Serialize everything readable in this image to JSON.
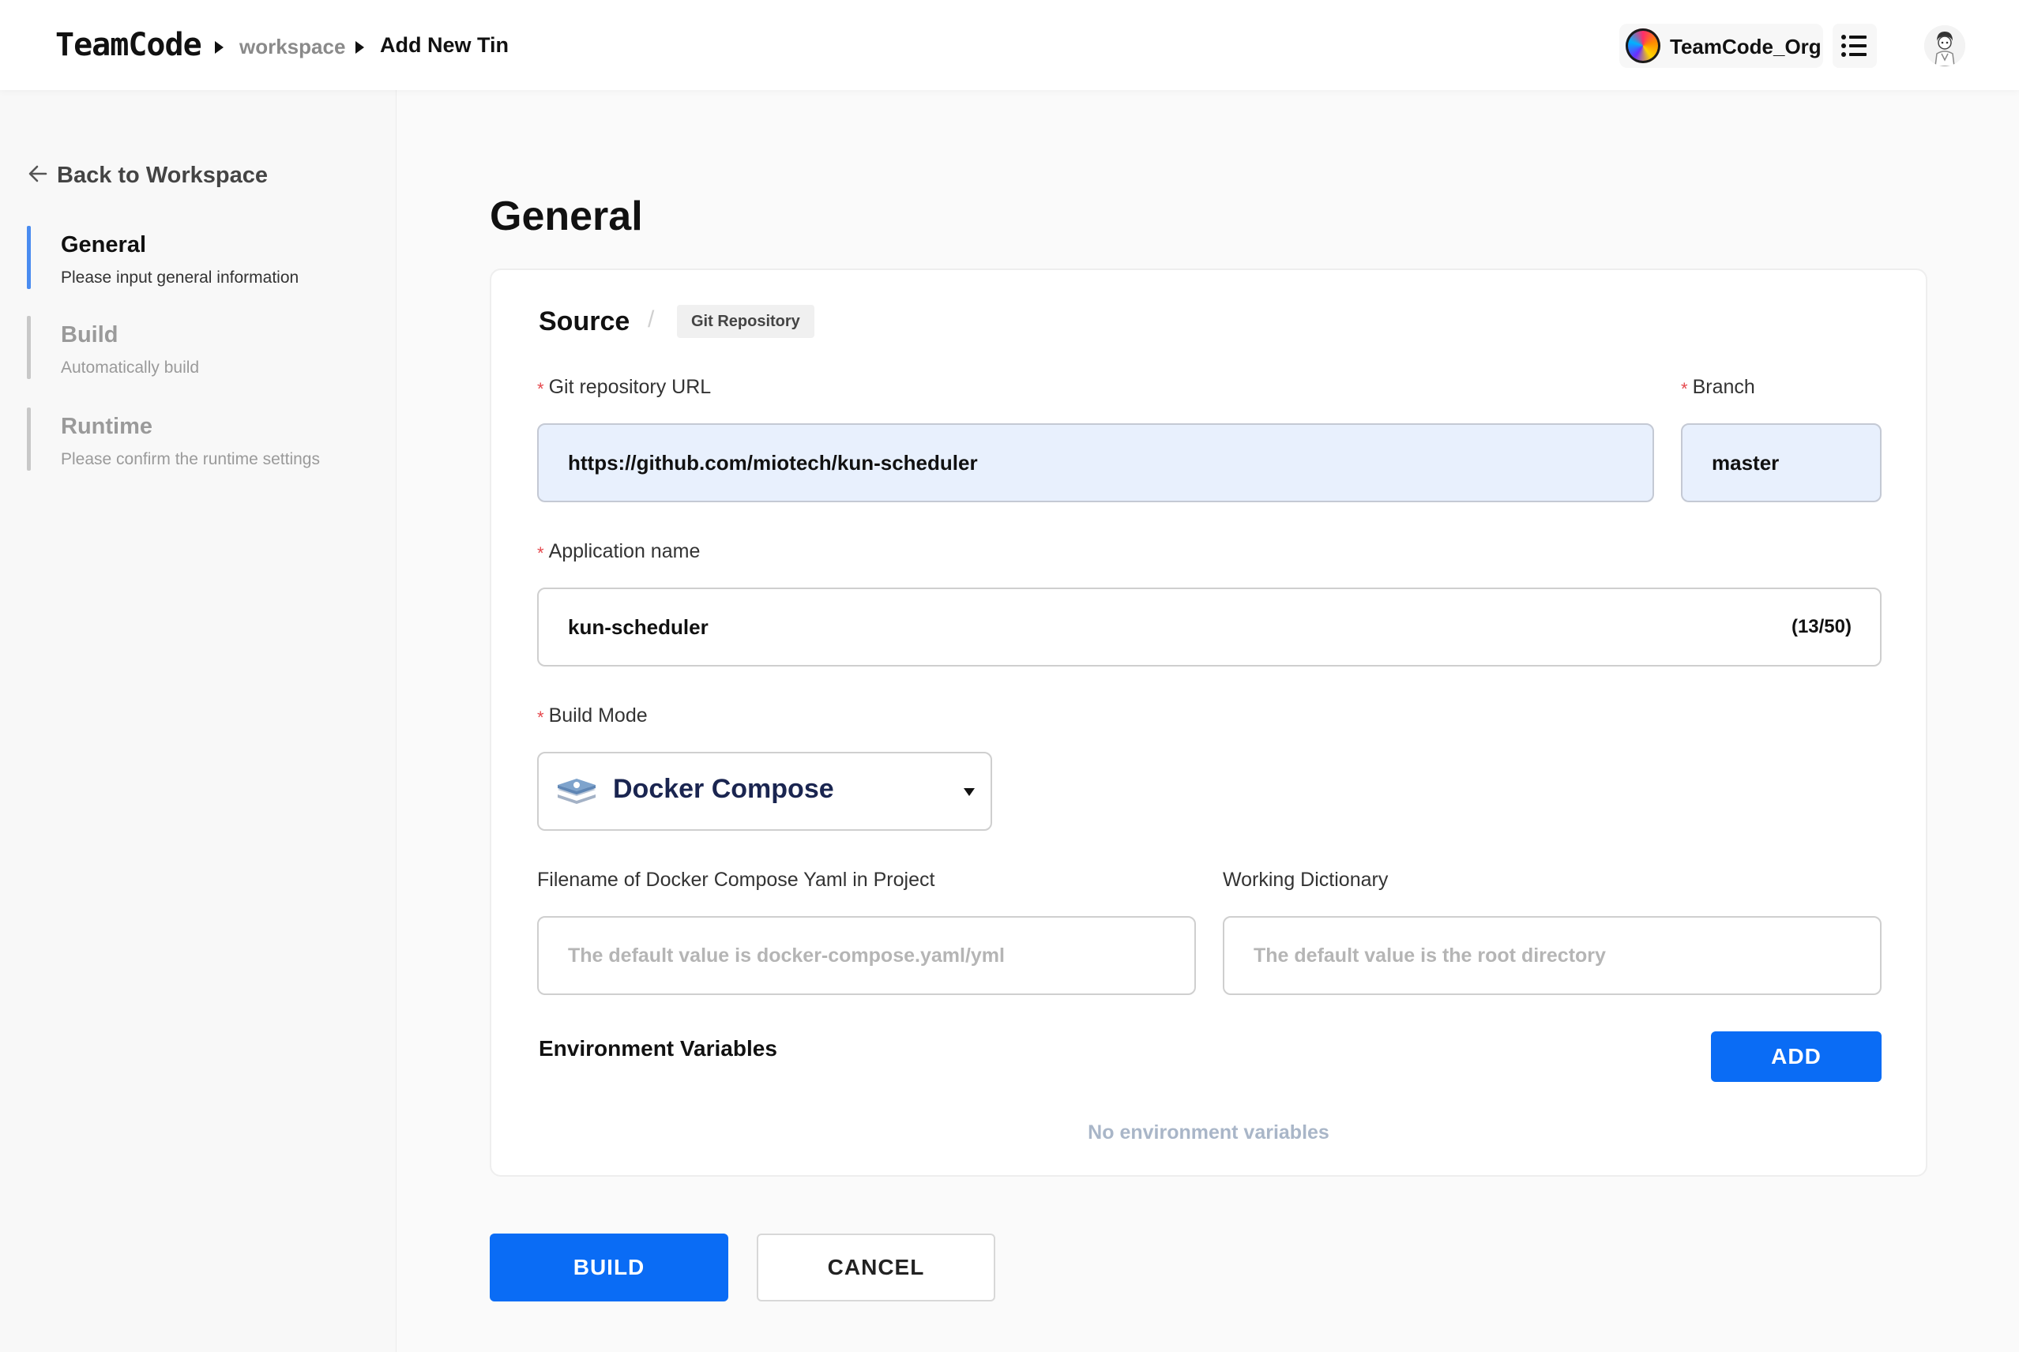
{
  "header": {
    "logo": "TeamCode",
    "breadcrumb": [
      "workspace",
      "Add New Tin"
    ],
    "org_name": "TeamCode_Org"
  },
  "sidebar": {
    "back_label": "Back to Workspace",
    "steps": [
      {
        "title": "General",
        "desc": "Please input general information",
        "active": true
      },
      {
        "title": "Build",
        "desc": "Automatically build",
        "active": false
      },
      {
        "title": "Runtime",
        "desc": "Please confirm the runtime settings",
        "active": false
      }
    ]
  },
  "main": {
    "page_title": "General",
    "source": {
      "title": "Source",
      "tag": "Git Repository"
    },
    "fields": {
      "git_url_label": "Git repository URL",
      "git_url_value": "https://github.com/miotech/kun-scheduler",
      "branch_label": "Branch",
      "branch_value": "master",
      "app_name_label": "Application name",
      "app_name_value": "kun-scheduler",
      "app_name_counter": "(13/50)",
      "build_mode_label": "Build Mode",
      "build_mode_value": "Docker Compose",
      "compose_file_label": "Filename of Docker Compose Yaml in Project",
      "compose_file_placeholder": "The default value is docker-compose.yaml/yml",
      "workdir_label": "Working Dictionary",
      "workdir_placeholder": "The default value is the root directory"
    },
    "env": {
      "title": "Environment Variables",
      "add_label": "ADD",
      "empty_text": "No environment variables"
    },
    "actions": {
      "build_label": "BUILD",
      "cancel_label": "CANCEL"
    }
  },
  "colors": {
    "primary": "#0a6cf5",
    "active_step": "#4a8cf0",
    "required": "#e5484d",
    "filled_input_bg": "#e8f0fd"
  },
  "icons": {
    "back": "arrow-left-icon",
    "menu": "list-icon",
    "build_mode": "docker-compose-icon",
    "select": "caret-down-icon"
  }
}
